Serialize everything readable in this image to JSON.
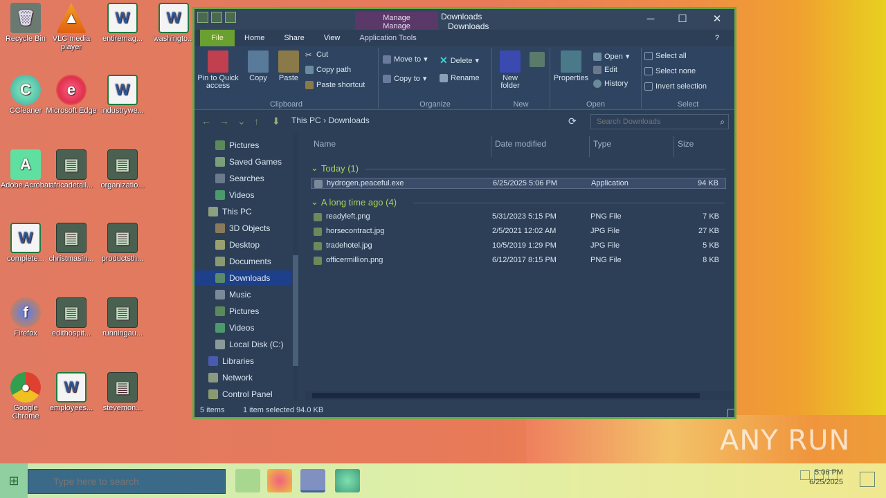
{
  "desktop": {
    "icons": [
      {
        "label": "Recycle Bin",
        "type": "bin"
      },
      {
        "label": "VLC media player",
        "type": "vlc"
      },
      {
        "label": "entiremag...",
        "type": "word"
      },
      {
        "label": "washingto...",
        "type": "word"
      },
      {
        "label": "CCleaner",
        "type": "app"
      },
      {
        "label": "Microsoft Edge",
        "type": "edge"
      },
      {
        "label": "industrywe...",
        "type": "word"
      },
      {
        "label": "Adobe Acrobat",
        "type": "acrobat"
      },
      {
        "label": "africadetail...",
        "type": "file"
      },
      {
        "label": "organizatio...",
        "type": "file"
      },
      {
        "label": "complete...",
        "type": "word"
      },
      {
        "label": "christmasin...",
        "type": "file"
      },
      {
        "label": "productsth...",
        "type": "file"
      },
      {
        "label": "Firefox",
        "type": "firefox"
      },
      {
        "label": "edithospit...",
        "type": "file"
      },
      {
        "label": "runningau...",
        "type": "file"
      },
      {
        "label": "Google Chrome",
        "type": "chrome"
      },
      {
        "label": "employees...",
        "type": "word"
      },
      {
        "label": "stevemon...",
        "type": "file"
      }
    ]
  },
  "window": {
    "title": "Downloads",
    "manage_label": "Manage",
    "tabs": {
      "file": "File",
      "home": "Home",
      "share": "Share",
      "view": "View",
      "app_tools": "Application Tools"
    },
    "ribbon": {
      "clipboard": {
        "label": "Clipboard",
        "pin": "Pin to Quick access",
        "copy": "Copy",
        "paste": "Paste",
        "cut": "Cut",
        "copy_path": "Copy path",
        "paste_shortcut": "Paste shortcut"
      },
      "organize": {
        "label": "Organize",
        "move_to": "Move to",
        "copy_to": "Copy to",
        "delete": "Delete",
        "rename": "Rename"
      },
      "new": {
        "label": "New",
        "new_folder": "New folder"
      },
      "open": {
        "label": "Open",
        "properties": "Properties",
        "open": "Open",
        "edit": "Edit",
        "history": "History"
      },
      "select": {
        "label": "Select",
        "select_all": "Select all",
        "select_none": "Select none",
        "invert": "Invert selection"
      }
    },
    "address": {
      "crumbs": [
        "This PC",
        "Downloads"
      ],
      "search_placeholder": "Search Downloads"
    },
    "nav_items": [
      {
        "label": "Pictures",
        "icon": "pictures-icon"
      },
      {
        "label": "Saved Games",
        "icon": "saved-games-icon"
      },
      {
        "label": "Searches",
        "icon": "search-folder-icon"
      },
      {
        "label": "Videos",
        "icon": "videos-icon"
      },
      {
        "label": "This PC",
        "icon": "computer-icon"
      },
      {
        "label": "3D Objects",
        "icon": "objects-3d-icon"
      },
      {
        "label": "Desktop",
        "icon": "desktop-folder-icon"
      },
      {
        "label": "Documents",
        "icon": "documents-icon"
      },
      {
        "label": "Downloads",
        "icon": "downloads-icon",
        "selected": true
      },
      {
        "label": "Music",
        "icon": "music-icon"
      },
      {
        "label": "Pictures",
        "icon": "pictures-icon"
      },
      {
        "label": "Videos",
        "icon": "videos-icon"
      },
      {
        "label": "Local Disk (C:)",
        "icon": "disk-icon"
      },
      {
        "label": "Libraries",
        "icon": "libraries-icon"
      },
      {
        "label": "Network",
        "icon": "network-icon"
      },
      {
        "label": "Control Panel",
        "icon": "control-panel-icon"
      }
    ],
    "columns": {
      "name": "Name",
      "date": "Date modified",
      "type": "Type",
      "size": "Size"
    },
    "groups": [
      {
        "title": "Today (1)",
        "files": [
          {
            "name": "hydrogen.peaceful.exe",
            "date": "6/25/2025 5:06 PM",
            "type": "Application",
            "size": "94 KB",
            "selected": true
          }
        ]
      },
      {
        "title": "A long time ago (4)",
        "files": [
          {
            "name": "readyleft.png",
            "date": "5/31/2023 5:15 PM",
            "type": "PNG File",
            "size": "7 KB"
          },
          {
            "name": "horsecontract.jpg",
            "date": "2/5/2021 12:02 AM",
            "type": "JPG File",
            "size": "27 KB"
          },
          {
            "name": "tradehotel.jpg",
            "date": "10/5/2019 1:29 PM",
            "type": "JPG File",
            "size": "5 KB"
          },
          {
            "name": "officermillion.png",
            "date": "6/12/2017 8:15 PM",
            "type": "PNG File",
            "size": "8 KB"
          }
        ]
      }
    ],
    "status": {
      "count": "5 items",
      "selection": "1 item selected  94.0 KB"
    }
  },
  "taskbar": {
    "search_placeholder": "Type here to search",
    "time": "5:06 PM",
    "date": "6/25/2025"
  },
  "watermark": "ANY RUN"
}
